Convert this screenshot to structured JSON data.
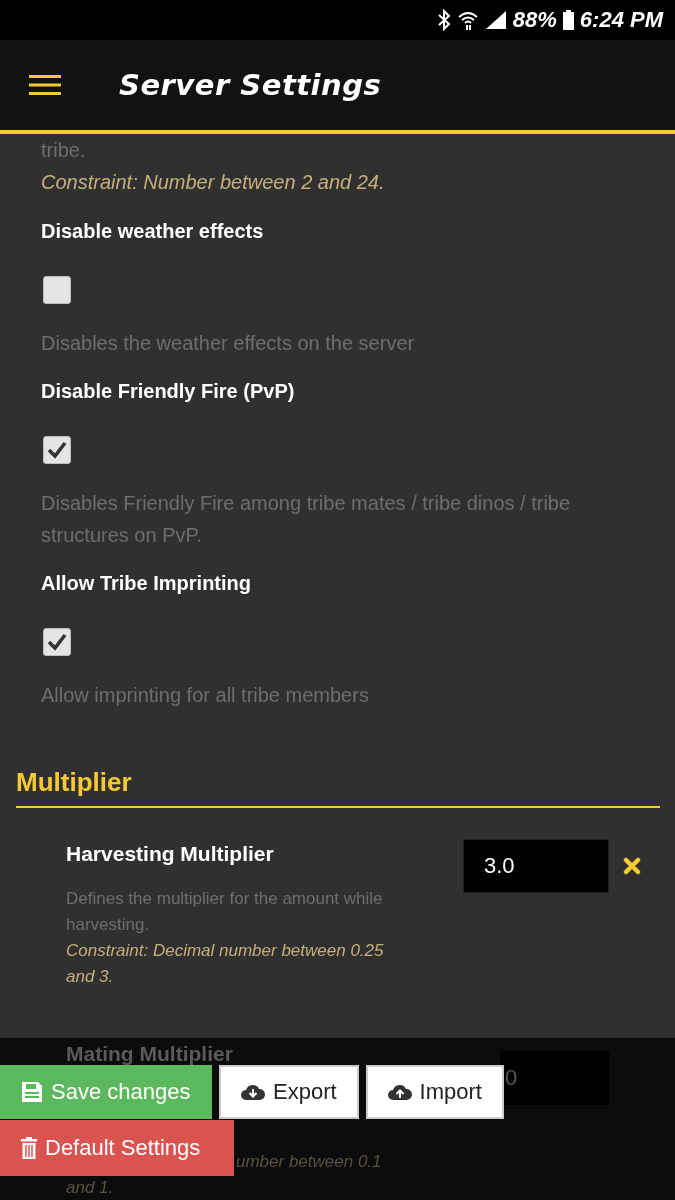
{
  "status_bar": {
    "battery": "88%",
    "time": "6:24 PM"
  },
  "app_bar": {
    "title": "Server Settings"
  },
  "top_fragment": {
    "description": "tribe.",
    "constraint": "Constraint: Number between 2 and 24."
  },
  "settings": [
    {
      "title": "Disable weather effects",
      "checked": false,
      "description": "Disables the weather effects on the server"
    },
    {
      "title": "Disable Friendly Fire (PvP)",
      "checked": true,
      "description": "Disables Friendly Fire among tribe mates / tribe dinos / tribe structures on PvP."
    },
    {
      "title": "Allow Tribe Imprinting",
      "checked": true,
      "description": "Allow imprinting for all tribe members"
    }
  ],
  "section": {
    "heading": "Multiplier",
    "items": [
      {
        "title": "Harvesting Multiplier",
        "value": "3.0",
        "description": "Defines the multiplier for the amount while harvesting.",
        "constraint": "Constraint: Decimal number between 0.25 and 3."
      }
    ],
    "partial_item": {
      "title": "Mating Multiplier",
      "value": "0",
      "constraint_lines": [
        "umber between 0.1",
        "and 1."
      ]
    }
  },
  "actions": [
    {
      "label": "Save changes",
      "kind": "save"
    },
    {
      "label": "Export",
      "kind": "export"
    },
    {
      "label": "Import",
      "kind": "import"
    },
    {
      "label": "Default Settings",
      "kind": "default"
    }
  ]
}
